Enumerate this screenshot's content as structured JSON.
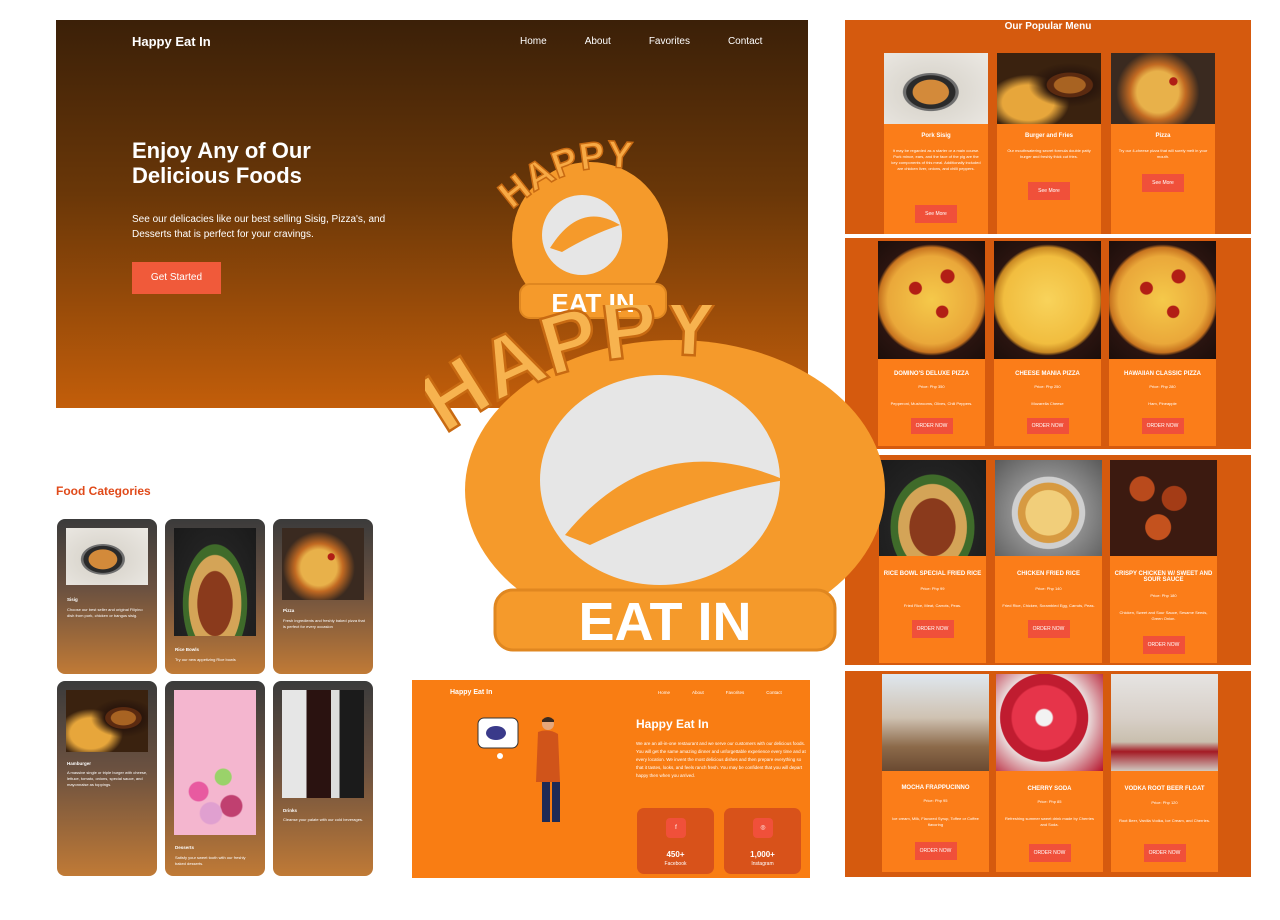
{
  "hero": {
    "brand": "Happy Eat In",
    "nav": [
      "Home",
      "About",
      "Favorites",
      "Contact"
    ],
    "heading": "Enjoy Any of Our Delicious Foods",
    "subtext": "See our delicacies like our best selling Sisig, Pizza's, and Desserts that is perfect for your cravings.",
    "cta": "Get Started"
  },
  "logo_small": {
    "top_text": "HAPPY",
    "bottom_text": "EAT IN"
  },
  "logo_large": {
    "top_text": "HAPPY",
    "bottom_text": "EAT IN"
  },
  "popular": {
    "title": "Our Popular Menu",
    "items": [
      {
        "name": "Pork Sisig",
        "desc": "It may be regarded as a starter or a main course. Pork mince, ears, and the face of the pig are the key components of this meal. Additionally included are chicken liver, onions, and chilli peppers.",
        "button": "See More",
        "image": "sisig-photo"
      },
      {
        "name": "Burger and Fries",
        "desc": "Our mouthwatering secret formula double patty burger and freshly thick cut fries.",
        "button": "See More",
        "image": "burger-photo"
      },
      {
        "name": "Pizza",
        "desc": "Try our 4-cheese pizza that will surely melt in your mouth.",
        "button": "See More",
        "image": "pizza-photo"
      }
    ]
  },
  "pizzas": [
    {
      "name": "DOMINO'S DELUXE PIZZA",
      "price": "Price: Php 350",
      "desc": "Pepperoni, Mushrooms, Olives, Chili Peppers.",
      "button": "ORDER NOW"
    },
    {
      "name": "CHEESE MANIA PIZZA",
      "price": "Price: Php 250",
      "desc": "Mozarella Cheese",
      "button": "ORDER NOW"
    },
    {
      "name": "HAWAIIAN CLASSIC PIZZA",
      "price": "Price: Php 280",
      "desc": "Ham, Pineapple",
      "button": "ORDER NOW"
    }
  ],
  "rice": [
    {
      "name": "RICE BOWL SPECIAL FRIED RICE",
      "price": "Price: Php 99",
      "desc": "Fried Rice, Meat, Carrots, Peas.",
      "button": "ORDER NOW"
    },
    {
      "name": "CHICKEN FRIED RICE",
      "price": "Price: Php 140",
      "desc": "Fried Rice, Chicken, Scrambled Egg, Carrots, Peas.",
      "button": "ORDER NOW"
    },
    {
      "name": "CRISPY CHICKEN W/ SWEET AND SOUR SAUCE",
      "price": "Price: Php 180",
      "desc": "Chicken, Sweet and Sour Sauce, Sesame Seeds, Green Onion.",
      "button": "ORDER NOW"
    }
  ],
  "drinks": [
    {
      "name": "MOCHA FRAPPUCINNO",
      "price": "Price: Php 95",
      "desc": "Ice cream, Milk, Flavored Syrup, Toffee or Coffee flavoring",
      "button": "ORDER NOW"
    },
    {
      "name": "CHERRY SODA",
      "price": "Price: Php 85",
      "desc": "Refreshing summer sweet drink made by Cherries and Soda.",
      "button": "ORDER NOW"
    },
    {
      "name": "VODKA ROOT BEER FLOAT",
      "price": "Price: Php 120",
      "desc": "Root Beer, Vanilla Vodka, Ice Cream, and Cherries.",
      "button": "ORDER NOW"
    }
  ],
  "categories": {
    "title": "Food Categories",
    "items": [
      {
        "name": "Sisig",
        "desc": "Choose our best seller and original Filipino dish from pork, chicken or bangus sisig."
      },
      {
        "name": "Rice Bowls",
        "desc": "Try our new appetizing Rice bowls"
      },
      {
        "name": "Pizza",
        "desc": "Fresh ingredients and freshly baked pizza that is perfect for every occasion"
      },
      {
        "name": "Hamburger",
        "desc": "A massive single or triple burger with cheese, lettuce, tomato, onions, special sauce, and mayonnaise as toppings."
      },
      {
        "name": "Desserts",
        "desc": "Satisfy your sweet tooth with our freshly baked desserts."
      },
      {
        "name": "Drinks",
        "desc": "Cleanse your palate with our cold beverages."
      }
    ]
  },
  "about": {
    "brand": "Happy Eat In",
    "nav": [
      "Home",
      "About",
      "Favorites",
      "Contact"
    ],
    "title": "Happy Eat In",
    "text": "We are an all-in-one restaurant and we serve our customers with our delicious foods. You will get the same amazing dinner and unforgettable experience every time and at every location. We invent the most delicious dishes and then prepare everything so that it tastes, looks, and feels ranch fresh. You may be confident that you will depart happy then when you arrived.",
    "stats": [
      {
        "icon": "f",
        "number": "450+",
        "label": "Facebook"
      },
      {
        "icon": "◎",
        "number": "1,000+",
        "label": "Instagram"
      }
    ]
  },
  "colors": {
    "orange": "#fb7d19",
    "dark_orange": "#d55a0e",
    "button_red": "#f0503a",
    "logo_orange": "#f59a2b",
    "logo_grey": "#e0e0e0"
  }
}
